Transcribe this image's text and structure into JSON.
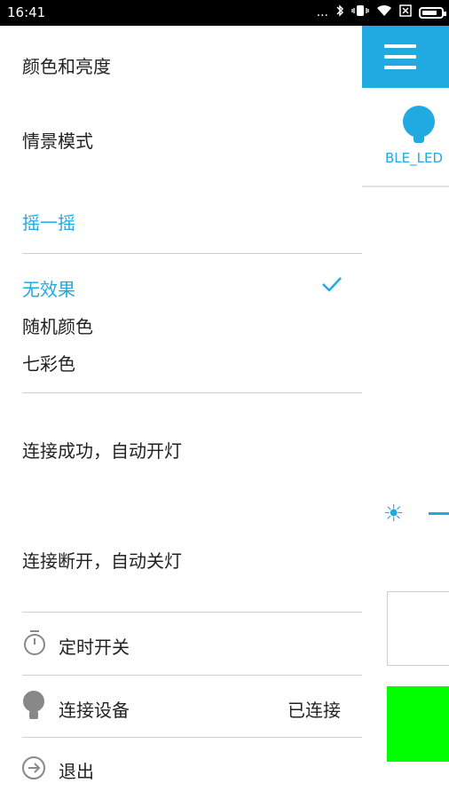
{
  "status_bar": {
    "time": "16:41",
    "dots": "...",
    "icons": [
      "bluetooth-icon",
      "vibrate-icon",
      "wifi-icon",
      "sim-icon",
      "battery-icon"
    ]
  },
  "colors": {
    "accent": "#21a9e1",
    "swatch_green": "#00ff00",
    "swatch_white": "#ffffff"
  },
  "drawer": {
    "color_brightness": "颜色和亮度",
    "scene_mode": "情景模式",
    "shake": {
      "header": "摇一摇",
      "options": [
        "无效果",
        "随机颜色",
        "七彩色"
      ],
      "selected": "无效果"
    },
    "connect_on": "连接成功，自动开灯",
    "disconnect_off": "连接断开，自动关灯",
    "timer": "定时开关",
    "device": {
      "label": "连接设备",
      "status": "已连接"
    },
    "exit": "退出"
  },
  "background_app": {
    "device_name": "BLE_LED"
  }
}
